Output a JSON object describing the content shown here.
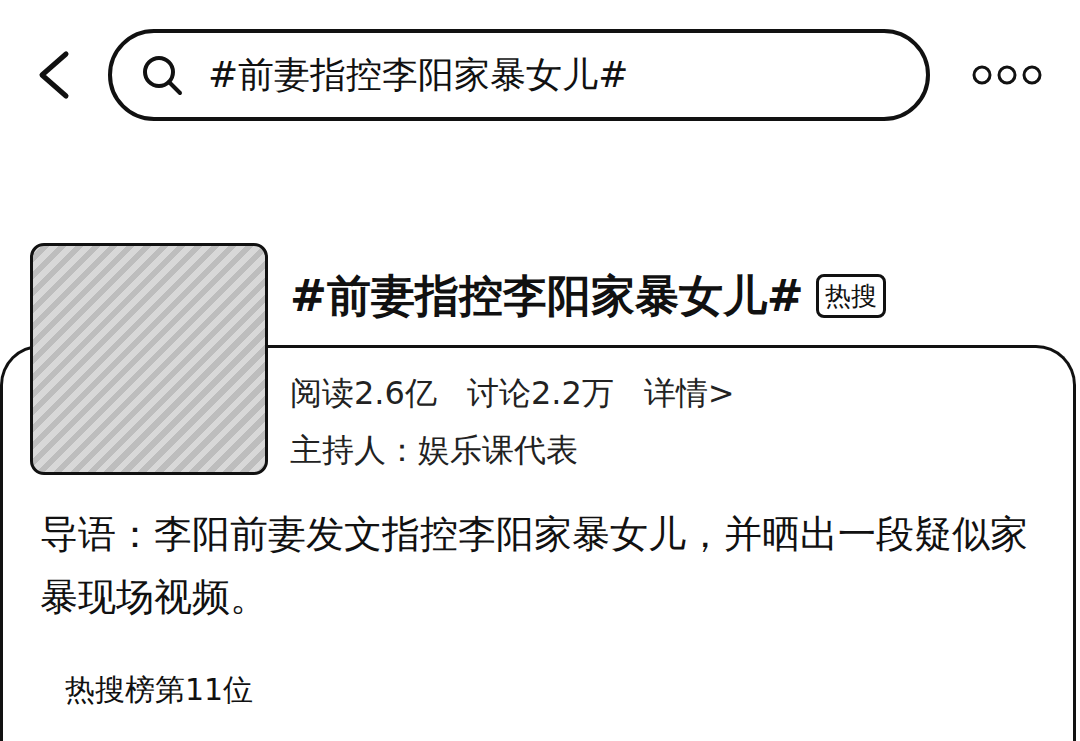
{
  "search": {
    "query": "#前妻指控李阳家暴女儿#"
  },
  "topic": {
    "title": "#前妻指控李阳家暴女儿#",
    "badge": "热搜",
    "stats": [
      "阅读2.6亿",
      "讨论2.2万",
      "详情>"
    ],
    "host": "主持人：娱乐课代表"
  },
  "intro": "导语：李阳前妻发文指控李阳家暴女儿，并晒出一段疑似家暴现场视频。",
  "rank": "热搜榜第11位"
}
